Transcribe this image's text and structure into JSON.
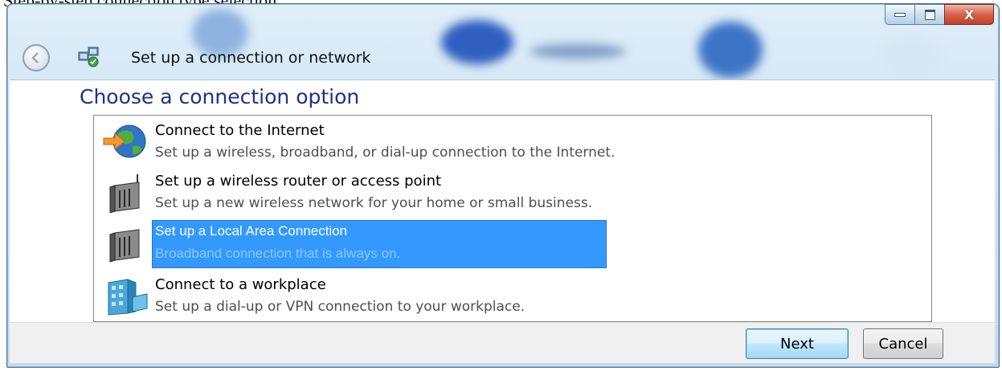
{
  "page_top_text": "Step-by-step connection type selection.",
  "window": {
    "title": "Set up a connection or network",
    "controls": {
      "minimize": "minimize",
      "maximize": "maximize",
      "close": "X"
    }
  },
  "heading": "Choose a connection option",
  "options": [
    {
      "title": "Connect to the Internet",
      "description": "Set up a wireless, broadband, or dial-up connection to the Internet.",
      "icon": "globe-internet-icon",
      "selected": false
    },
    {
      "title": "Set up a wireless router or access point",
      "description": "Set up a new wireless network for your home or small business.",
      "icon": "router-icon",
      "selected": false
    },
    {
      "title": "Set up a Local Area Connection",
      "description": "Broadband connection that is always on.",
      "icon": "router-icon",
      "selected": true
    },
    {
      "title": "Connect to a workplace",
      "description": "Set up a dial-up or VPN connection to your workplace.",
      "icon": "workplace-icon",
      "selected": false
    }
  ],
  "buttons": {
    "next": "Next",
    "cancel": "Cancel"
  },
  "colors": {
    "selection": "#3399ff",
    "heading": "#1e3287",
    "close_button": "#c2402a"
  }
}
